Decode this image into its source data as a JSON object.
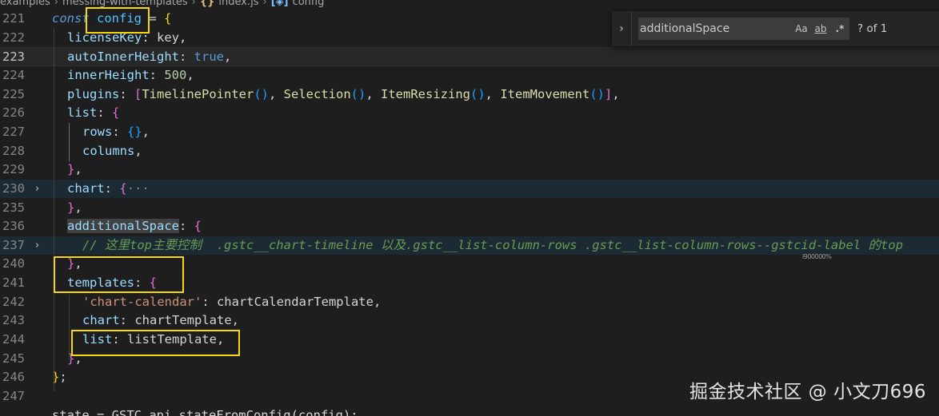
{
  "breadcrumb": {
    "items": [
      "examples",
      "messing-with-templates",
      "index.js",
      "config"
    ],
    "file_icon": "{}",
    "symbol_icon": "[◈]"
  },
  "find_widget": {
    "query": "additionalSpace",
    "match_case_label": "Aa",
    "whole_word_label": "ab",
    "regex_label": ".*",
    "result_count": "? of 1",
    "toggle_icon": "chevron-right-icon"
  },
  "code": {
    "lines": [
      {
        "n": "221",
        "t": [
          [
            "kw",
            "const"
          ],
          [
            "plain",
            " "
          ],
          [
            "var",
            "config"
          ],
          [
            "plain",
            " = "
          ],
          [
            "br1",
            "{"
          ]
        ]
      },
      {
        "n": "222",
        "t": [
          [
            "prop",
            "licenseKey"
          ],
          [
            "plain",
            ": key,"
          ]
        ]
      },
      {
        "n": "223",
        "t": [
          [
            "prop",
            "autoInnerHeight"
          ],
          [
            "plain",
            ": "
          ],
          [
            "bool",
            "true"
          ],
          [
            "plain",
            ","
          ]
        ],
        "current": true
      },
      {
        "n": "224",
        "t": [
          [
            "prop",
            "innerHeight"
          ],
          [
            "plain",
            ": "
          ],
          [
            "num",
            "500"
          ],
          [
            "plain",
            ","
          ]
        ]
      },
      {
        "n": "225",
        "t": [
          [
            "prop",
            "plugins"
          ],
          [
            "plain",
            ": "
          ],
          [
            "br2",
            "["
          ],
          [
            "fn",
            "TimelinePointer"
          ],
          [
            "br3",
            "()"
          ],
          [
            "plain",
            ", "
          ],
          [
            "fn",
            "Selection"
          ],
          [
            "br3",
            "()"
          ],
          [
            "plain",
            ", "
          ],
          [
            "fn",
            "ItemResizing"
          ],
          [
            "br3",
            "()"
          ],
          [
            "plain",
            ", "
          ],
          [
            "fn",
            "ItemMovement"
          ],
          [
            "br3",
            "()"
          ],
          [
            "br2",
            "]"
          ],
          [
            "plain",
            ","
          ]
        ]
      },
      {
        "n": "226",
        "t": [
          [
            "prop",
            "list"
          ],
          [
            "plain",
            ": "
          ],
          [
            "br2",
            "{"
          ]
        ]
      },
      {
        "n": "227",
        "t": [
          [
            "prop",
            "rows"
          ],
          [
            "plain",
            ": "
          ],
          [
            "br3",
            "{}"
          ],
          [
            "plain",
            ","
          ]
        ]
      },
      {
        "n": "228",
        "t": [
          [
            "prop",
            "columns"
          ],
          [
            "plain",
            ","
          ]
        ]
      },
      {
        "n": "229",
        "t": [
          [
            "br2",
            "}"
          ],
          [
            "plain",
            ","
          ]
        ]
      },
      {
        "n": "230",
        "t": [
          [
            "prop",
            "chart"
          ],
          [
            "plain",
            ": "
          ],
          [
            "br2",
            "{"
          ],
          [
            "ellipsis",
            "···"
          ]
        ],
        "fold": true,
        "foldBg": true
      },
      {
        "n": "235",
        "t": [
          [
            "br2",
            "}"
          ],
          [
            "plain",
            ","
          ]
        ]
      },
      {
        "n": "236",
        "t": [
          [
            "prop",
            "additionalSpace"
          ],
          [
            "plain",
            ": "
          ],
          [
            "br2",
            "{"
          ]
        ]
      },
      {
        "n": "237",
        "t": [
          [
            "cmt",
            "// 这里top主要控制  .gstc__chart-timeline 以及.gstc__list-column-rows .gstc__list-column-rows--gstcid-label 的top"
          ]
        ],
        "fold": true,
        "foldBg": true
      },
      {
        "n": "240",
        "t": [
          [
            "br2",
            "}"
          ],
          [
            "plain",
            ","
          ]
        ]
      },
      {
        "n": "241",
        "t": [
          [
            "prop",
            "templates"
          ],
          [
            "plain",
            ": "
          ],
          [
            "br2",
            "{"
          ]
        ]
      },
      {
        "n": "242",
        "t": [
          [
            "str",
            "'chart-calendar'"
          ],
          [
            "plain",
            ": chartCalendarTemplate,"
          ]
        ]
      },
      {
        "n": "243",
        "t": [
          [
            "prop",
            "chart"
          ],
          [
            "plain",
            ": chartTemplate,"
          ]
        ]
      },
      {
        "n": "244",
        "t": [
          [
            "prop",
            "list"
          ],
          [
            "plain",
            ": listTemplate,"
          ]
        ]
      },
      {
        "n": "245",
        "t": [
          [
            "br2",
            "}"
          ],
          [
            "plain",
            ","
          ]
        ]
      },
      {
        "n": "246",
        "t": [
          [
            "br1",
            "}"
          ],
          [
            "plain",
            ";"
          ]
        ]
      },
      {
        "n": "247",
        "t": []
      },
      {
        "n": "",
        "t": [
          [
            "plain",
            "state = GSTC.api.stateFromConfig(config);"
          ]
        ]
      }
    ]
  },
  "inline_hint": "i900000%",
  "watermark": "掘金技术社区 @ 小文刀696"
}
